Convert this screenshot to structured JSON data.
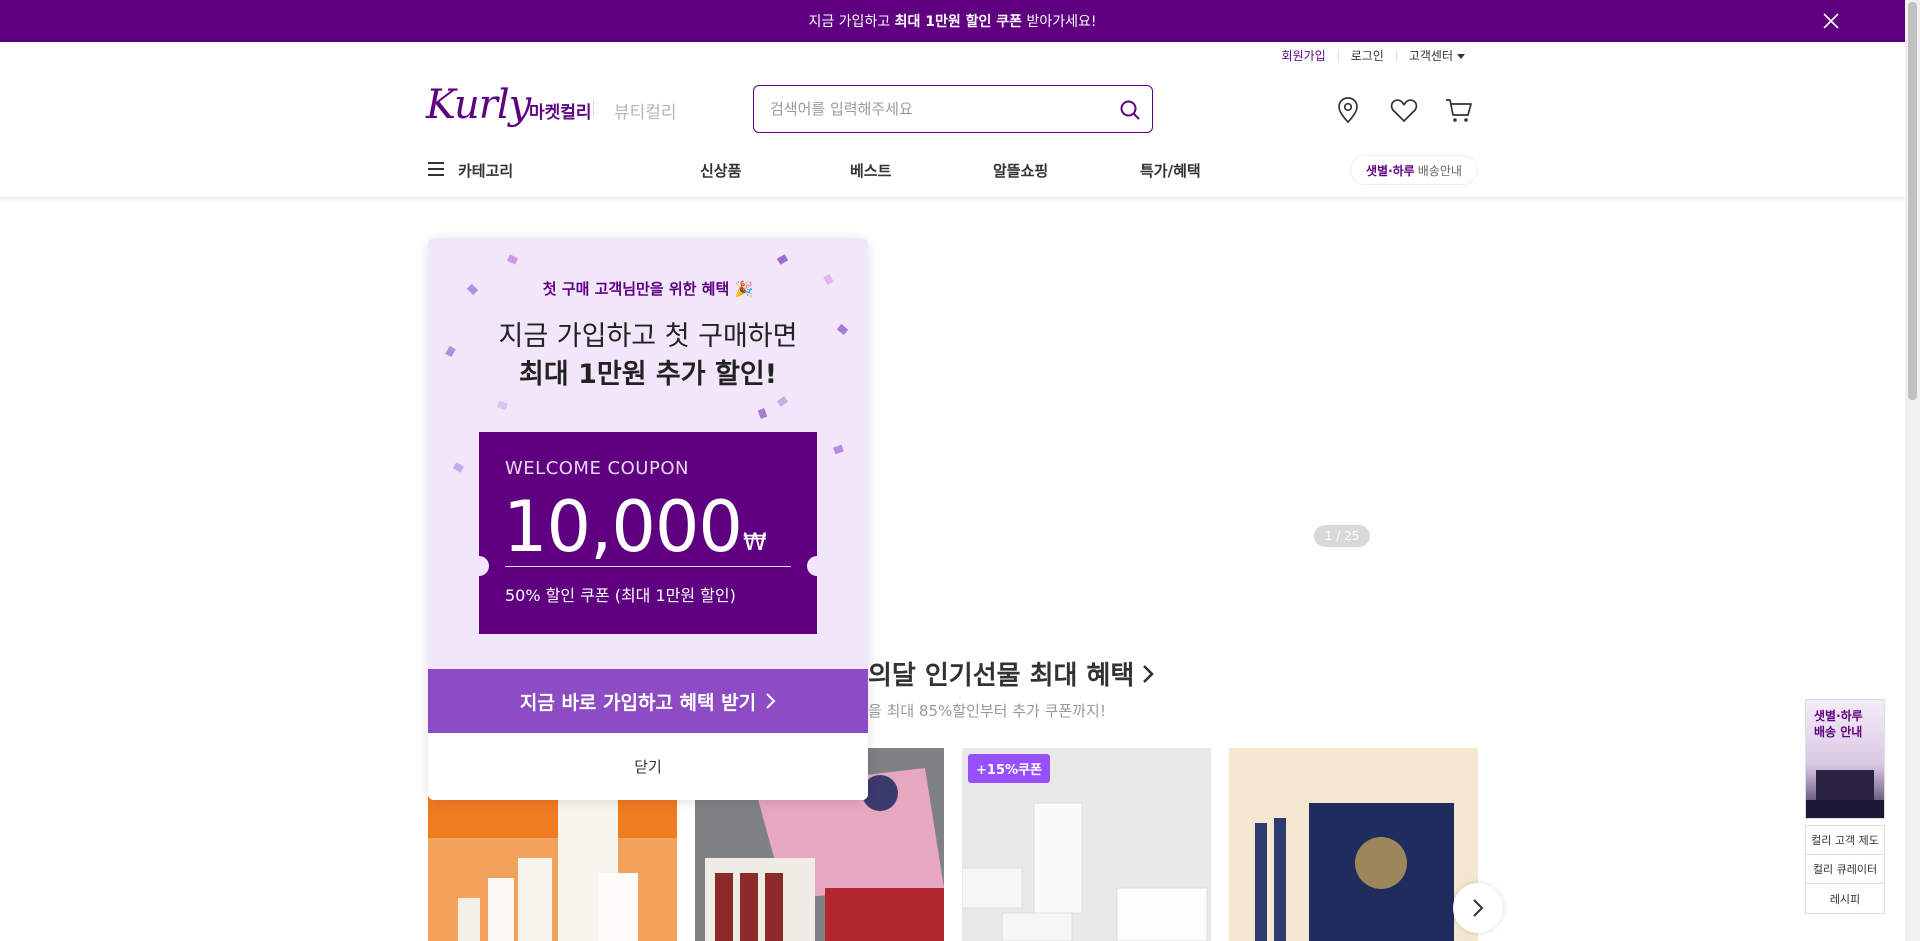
{
  "promo": {
    "text_before": "지금 가입하고 ",
    "text_bold": "최대 1만원 할인 쿠폰",
    "text_after": " 받아가세요!",
    "close_icon": "close-icon"
  },
  "util_links": {
    "signup": "회원가입",
    "login": "로그인",
    "customer_center": "고객센터"
  },
  "header": {
    "logo": "Kurly",
    "market_tab": "마켓컬리",
    "beauty_tab": "뷰티컬리",
    "search_placeholder": "검색어를 입력해주세요",
    "icons": [
      "location-icon",
      "heart-icon",
      "cart-icon"
    ]
  },
  "nav": {
    "category": "카테고리",
    "items": [
      "신상품",
      "베스트",
      "알뜰쇼핑",
      "특가/혜택"
    ],
    "delivery_bold": "샛별·하루",
    "delivery_rest": "배송안내"
  },
  "banner": {
    "page_indicator": "1 / 25"
  },
  "section": {
    "title": "의달 인기선물 최대 혜택",
    "subtitle": "을 최대 85%할인부터 추가 쿠폰까지!"
  },
  "products": [
    {
      "badge": ""
    },
    {
      "badge": ""
    },
    {
      "badge": "+15%쿠폰"
    },
    {
      "badge": ""
    }
  ],
  "side": {
    "banner_text": "샛별·하루\n배송 안내",
    "menu": [
      "컬리 고객 제도",
      "컬리 큐레이터",
      "레시피"
    ]
  },
  "modal": {
    "small_title": "첫 구매 고객님만을 위한 혜택 🎉",
    "headline1": "지금 가입하고 첫 구매하면",
    "headline2": "최대 1만원 추가 할인!",
    "coupon_label": "WELCOME COUPON",
    "coupon_amount": "10,000",
    "coupon_currency": "₩",
    "coupon_desc": "50% 할인 쿠폰 (최대 1만원 할인)",
    "cta": "지금 바로 가입하고 혜택 받기",
    "close": "닫기"
  },
  "colors": {
    "brand": "#5f0080",
    "cta": "#8d4cc4",
    "badge": "#9850ff"
  }
}
